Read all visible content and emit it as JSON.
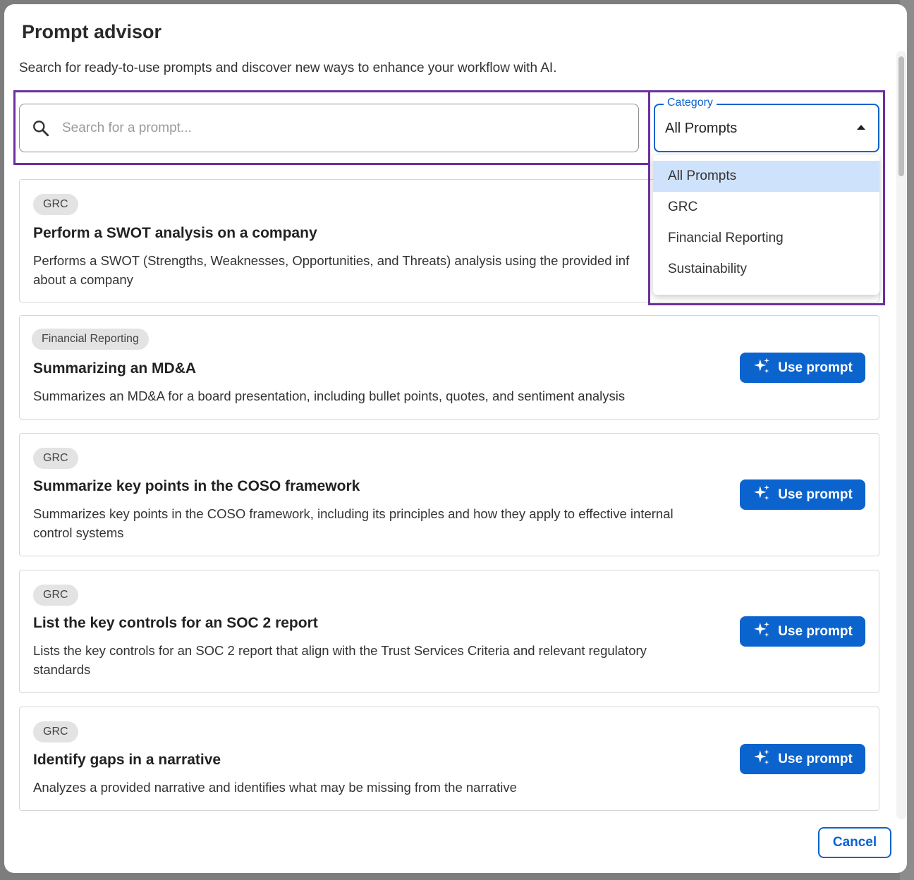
{
  "dialog": {
    "title": "Prompt advisor",
    "subtitle": "Search for ready-to-use prompts and discover new ways to enhance your workflow with AI."
  },
  "search": {
    "placeholder": "Search for a prompt...",
    "value": ""
  },
  "category": {
    "label": "Category",
    "value": "All Prompts",
    "options": [
      "All Prompts",
      "GRC",
      "Financial Reporting",
      "Sustainability"
    ],
    "selected_index": 0
  },
  "prompts": [
    {
      "tag": "GRC",
      "title": "Perform a SWOT analysis on a company",
      "description_line1": "Performs a SWOT (Strengths, Weaknesses, Opportunities, and Threats) analysis using the provided inf",
      "description_line2": "about a company"
    },
    {
      "tag": "Financial Reporting",
      "title": "Summarizing an MD&A",
      "description_line1": "Summarizes an MD&A for a board presentation, including bullet points, quotes, and sentiment analysis",
      "description_line2": "",
      "button": "Use prompt"
    },
    {
      "tag": "GRC",
      "title": "Summarize key points in the COSO framework",
      "description_line1": "Summarizes key points in the COSO framework, including its principles and how they apply to effective internal",
      "description_line2": "control systems",
      "button": "Use prompt"
    },
    {
      "tag": "GRC",
      "title": "List the key controls for an SOC 2 report",
      "description_line1": "Lists the key controls for an SOC 2 report that align with the Trust Services Criteria and relevant regulatory",
      "description_line2": "standards",
      "button": "Use prompt"
    },
    {
      "tag": "GRC",
      "title": "Identify gaps in a narrative",
      "description_line1": "Analyzes a provided narrative and identifies what may be missing from the narrative",
      "description_line2": "",
      "button": "Use prompt"
    }
  ],
  "footer": {
    "cancel_label": "Cancel"
  },
  "colors": {
    "accent": "#0b63ce",
    "highlight": "#6b2fa0",
    "selected_option": "#cfe2fb"
  }
}
